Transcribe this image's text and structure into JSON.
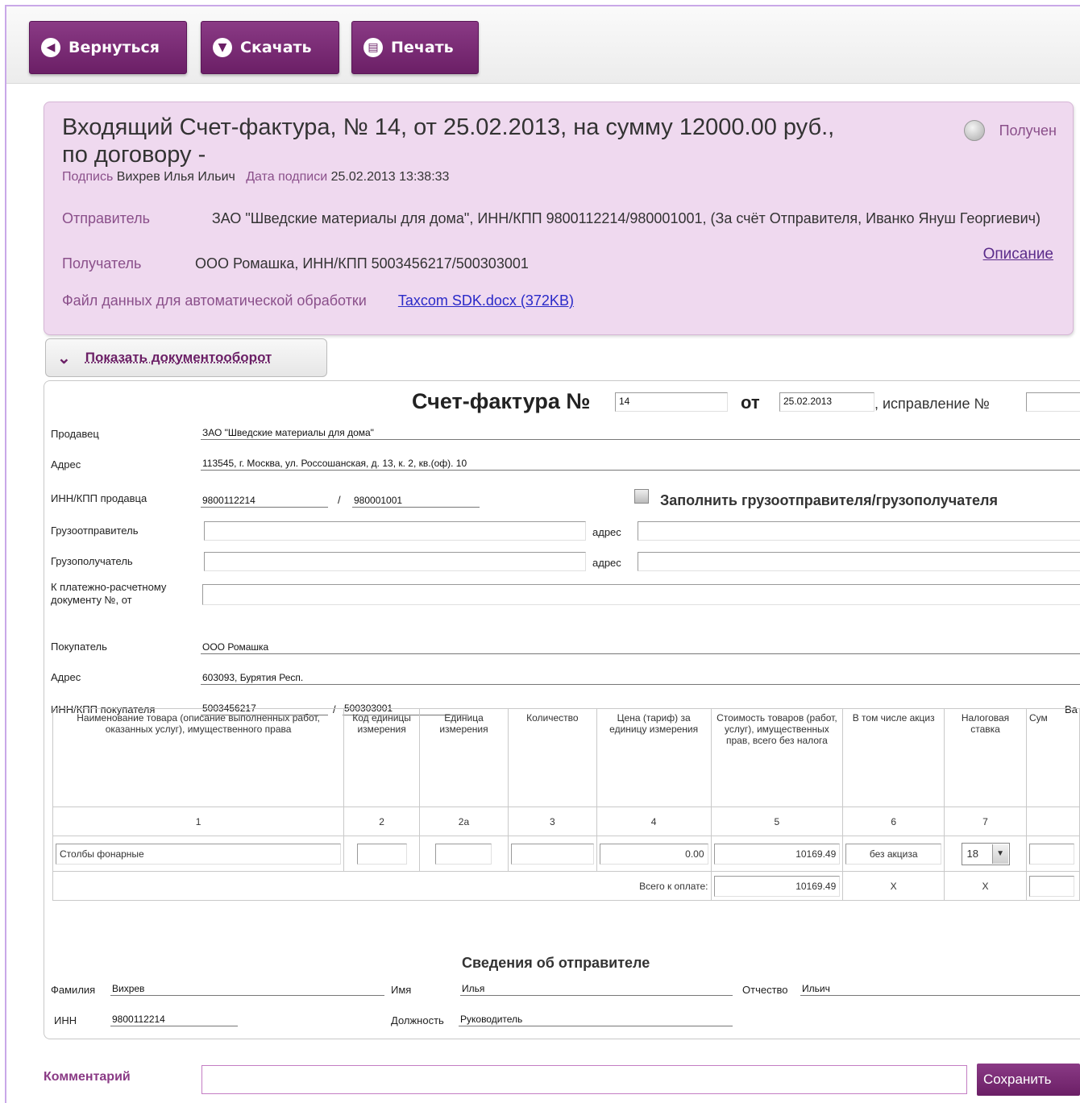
{
  "toolbar": {
    "back_label": "Вернуться",
    "download_label": "Скачать",
    "print_label": "Печать",
    "back_icon": "arrow-left-icon",
    "download_icon": "download-icon",
    "print_icon": "print-icon"
  },
  "summary": {
    "title": "Входящий Счет-фактура, № 14, от 25.02.2013, на сумму 12000.00 руб., по договору -",
    "status": "Получен",
    "signature_label": "Подпись",
    "signature_value": "Вихрев Илья Ильич",
    "sign_date_label": "Дата подписи",
    "sign_date_value": "25.02.2013 13:38:33",
    "sender_label": "Отправитель",
    "sender_value": "ЗАО \"Шведские материалы для дома\", ИНН/КПП 9800112214/980001001, (За счёт Отправителя, Иванко Януш Георгиевич)",
    "recipient_label": "Получатель",
    "recipient_value": "ООО Ромашка, ИНН/КПП 5003456217/500303001",
    "description_link": "Описание",
    "file_label": "Файл данных для автоматической обработки",
    "file_link": "Taxcom SDK.docx (372KB)"
  },
  "docflow": {
    "label": "Показать документооборот",
    "icon": "double-chevron-down-icon"
  },
  "invoice": {
    "title": "Счет-фактура №",
    "number": "14",
    "from_label": "от",
    "date": "25.02.2013",
    "correction_label": ", исправление №",
    "correction_value": "",
    "seller_label": "Продавец",
    "seller_value": "ЗАО \"Шведские материалы для дома\"",
    "seller_address_label": "Адрес",
    "seller_address_value": "113545, г. Москва, ул. Россошанская, д. 13, к. 2, кв.(оф). 10",
    "seller_inn_label": "ИНН/КПП продавца",
    "seller_inn": "9800112214",
    "seller_kpp": "980001001",
    "slash": "/",
    "fill_shipper_label": "Заполнить грузоотправителя/грузополучателя",
    "shipper_label": "Грузоотправитель",
    "consignee_label": "Грузополучатель",
    "address_word": "адрес",
    "payment_doc_label": "К платежно-расчетному документу №, от",
    "buyer_label": "Покупатель",
    "buyer_value": "ООО Ромашка",
    "buyer_address_label": "Адрес",
    "buyer_address_value": "603093, Бурятия Респ.",
    "buyer_inn_label": "ИНН/КПП покупателя",
    "buyer_inn": "5003456217",
    "buyer_kpp": "500303001",
    "currency_cut_label": "Ва"
  },
  "goods_table": {
    "headers": [
      "Наименование товара (описание выполненных работ, оказанных услуг), имущественного права",
      "Код единицы измерения",
      "Единица измерения",
      "Количество",
      "Цена (тариф) за единицу измерения",
      "Стоимость товаров (работ, услуг), имущественных прав, всего без налога",
      "В том числе акциз",
      "Налоговая ставка",
      "Сум"
    ],
    "numbers": [
      "1",
      "2",
      "2а",
      "3",
      "4",
      "5",
      "6",
      "7",
      ""
    ],
    "row": {
      "name": "Столбы фонарные",
      "unit_code": "",
      "unit": "",
      "quantity": "",
      "price": "0.00",
      "cost": "10169.49",
      "excise": "без акциза",
      "tax_rate": "18"
    },
    "total_label": "Всего к оплате:",
    "total_cost": "10169.49",
    "total_excise": "X",
    "total_rate": "X"
  },
  "sender_info": {
    "title": "Сведения об отправителе",
    "surname_label": "Фамилия",
    "surname": "Вихрев",
    "name_label": "Имя",
    "name": "Илья",
    "patronymic_label": "Отчество",
    "patronymic": "Ильич",
    "inn_label": "ИНН",
    "inn": "9800112214",
    "position_label": "Должность",
    "position": "Руководитель"
  },
  "comment": {
    "label": "Комментарий",
    "value": "",
    "save_label": "Сохранить"
  },
  "colors": {
    "accent": "#6b1f66",
    "summary_bg": "#efd9ef",
    "label_color": "#8a4f8a"
  }
}
